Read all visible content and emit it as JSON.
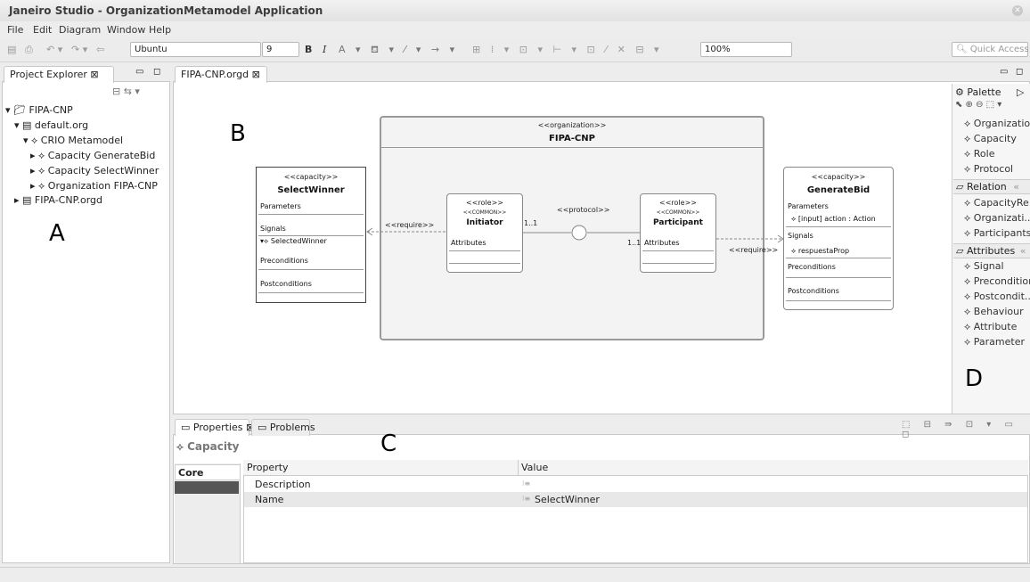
{
  "window": {
    "title": "Janeiro Studio - OrganizationMetamodel Application"
  },
  "menu": [
    "File",
    "Edit",
    "Diagram",
    "Window",
    "Help"
  ],
  "toolbar": {
    "font": "Ubuntu",
    "size": "9",
    "bold": "B",
    "italic": "I",
    "zoom": "100%",
    "quick_access": "Quick Access"
  },
  "explorer": {
    "tab": "Project Explorer ⊠",
    "items": [
      "FIPA-CNP",
      "default.org",
      "CRIO Metamodel",
      "Capacity GenerateBid",
      "Capacity SelectWinner",
      "Organization FIPA-CNP",
      "FIPA-CNP.orgd"
    ]
  },
  "editor": {
    "tab": "FIPA-CNP.orgd ⊠"
  },
  "labels": {
    "a": "A",
    "b": "B",
    "c": "C",
    "d": "D"
  },
  "diagram": {
    "org": {
      "stereo": "<<organization>>",
      "name": "FIPA-CNP"
    },
    "select": {
      "stereo": "<<capacity>>",
      "name": "SelectWinner",
      "parameters": "Parameters",
      "signals": "Signals",
      "signal_item": "SelectedWinner",
      "pre": "Preconditions",
      "post": "Postconditions"
    },
    "initiator": {
      "stereo": "<<role>>",
      "common": "<<COMMON>>",
      "name": "Initiator",
      "attributes": "Attributes"
    },
    "participant": {
      "stereo": "<<role>>",
      "common": "<<COMMON>>",
      "name": "Participant",
      "attributes": "Attributes"
    },
    "generate": {
      "stereo": "<<capacity>>",
      "name": "GenerateBid",
      "parameters": "Parameters",
      "param_item": "[input] action : Action",
      "signals": "Signals",
      "signal_item": "respuestaProp",
      "pre": "Preconditions",
      "post": "Postconditions"
    },
    "protocol": "<<protocol>>",
    "require1": "<<require>>",
    "require2": "<<require>>",
    "mult1": "1..1",
    "mult2": "1..1"
  },
  "palette": {
    "title": "Palette",
    "items": [
      "Organization",
      "Capacity",
      "Role",
      "Protocol"
    ],
    "relation": "Relation",
    "rel_items": [
      "CapacityRe...",
      "Organizati...",
      "Participants"
    ],
    "attributes": "Attributes",
    "attr_items": [
      "Signal",
      "Precondition",
      "Postcondit...",
      "Behaviour",
      "Attribute",
      "Parameter"
    ]
  },
  "bottom": {
    "tabs": [
      "Properties ⊠",
      "Problems"
    ],
    "section": "Capacity",
    "side_tabs": [
      "Core"
    ],
    "col_property": "Property",
    "col_value": "Value",
    "rows": [
      {
        "property": "Description",
        "value": ""
      },
      {
        "property": "Name",
        "value": "SelectWinner"
      }
    ]
  }
}
